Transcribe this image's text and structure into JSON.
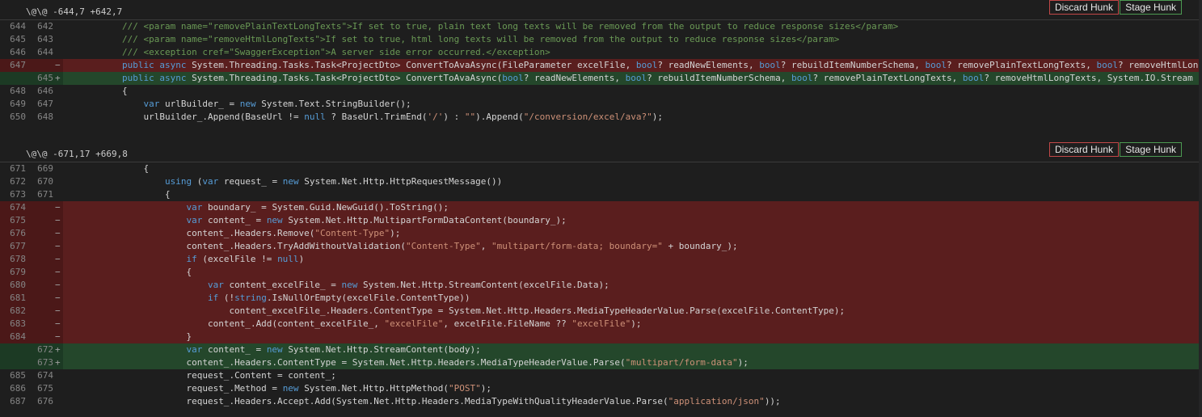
{
  "hunks": [
    {
      "title": "\\@\\@ -644,7 +642,7",
      "discard_label": "Discard Hunk",
      "stage_label": "Stage Hunk",
      "lines": [
        {
          "old": "644",
          "new": "642",
          "mark": "",
          "type": "ctx",
          "text": "        /// <param name=\"removePlainTextLongTexts\">If set to true, plain text long texts will be removed from the output to reduce response sizes</param>"
        },
        {
          "old": "645",
          "new": "643",
          "mark": "",
          "type": "ctx",
          "text": "        /// <param name=\"removeHtmlLongTexts\">If set to true, html long texts will be removed from the output to reduce response sizes</param>"
        },
        {
          "old": "646",
          "new": "644",
          "mark": "",
          "type": "ctx",
          "text": "        /// <exception cref=\"SwaggerException\">A server side error occurred.</exception>"
        },
        {
          "old": "647",
          "new": "",
          "mark": "−",
          "type": "del",
          "text": "        public async System.Threading.Tasks.Task<ProjectDto> ConvertToAvaAsync(FileParameter excelFile, bool? readNewElements, bool? rebuildItemNumberSchema, bool? removePlainTextLongTexts, bool? removeHtmlLongTex"
        },
        {
          "old": "",
          "new": "645",
          "mark": "+",
          "type": "add",
          "text": "        public async System.Threading.Tasks.Task<ProjectDto> ConvertToAvaAsync(bool? readNewElements, bool? rebuildItemNumberSchema, bool? removePlainTextLongTexts, bool? removeHtmlLongTexts, System.IO.Stream body"
        },
        {
          "old": "648",
          "new": "646",
          "mark": "",
          "type": "ctx",
          "text": "        {"
        },
        {
          "old": "649",
          "new": "647",
          "mark": "",
          "type": "ctx",
          "text": "            var urlBuilder_ = new System.Text.StringBuilder();"
        },
        {
          "old": "650",
          "new": "648",
          "mark": "",
          "type": "ctx",
          "text": "            urlBuilder_.Append(BaseUrl != null ? BaseUrl.TrimEnd('/') : \"\").Append(\"/conversion/excel/ava?\");"
        }
      ]
    },
    {
      "title": "\\@\\@ -671,17 +669,8",
      "discard_label": "Discard Hunk",
      "stage_label": "Stage Hunk",
      "lines": [
        {
          "old": "671",
          "new": "669",
          "mark": "",
          "type": "ctx",
          "text": "            {"
        },
        {
          "old": "672",
          "new": "670",
          "mark": "",
          "type": "ctx",
          "text": "                using (var request_ = new System.Net.Http.HttpRequestMessage())"
        },
        {
          "old": "673",
          "new": "671",
          "mark": "",
          "type": "ctx",
          "text": "                {"
        },
        {
          "old": "674",
          "new": "",
          "mark": "−",
          "type": "del",
          "text": "                    var boundary_ = System.Guid.NewGuid().ToString();"
        },
        {
          "old": "675",
          "new": "",
          "mark": "−",
          "type": "del",
          "text": "                    var content_ = new System.Net.Http.MultipartFormDataContent(boundary_);"
        },
        {
          "old": "676",
          "new": "",
          "mark": "−",
          "type": "del",
          "text": "                    content_.Headers.Remove(\"Content-Type\");"
        },
        {
          "old": "677",
          "new": "",
          "mark": "−",
          "type": "del",
          "text": "                    content_.Headers.TryAddWithoutValidation(\"Content-Type\", \"multipart/form-data; boundary=\" + boundary_);"
        },
        {
          "old": "678",
          "new": "",
          "mark": "−",
          "type": "del",
          "text": "                    if (excelFile != null)"
        },
        {
          "old": "679",
          "new": "",
          "mark": "−",
          "type": "del",
          "text": "                    {"
        },
        {
          "old": "680",
          "new": "",
          "mark": "−",
          "type": "del",
          "text": "                        var content_excelFile_ = new System.Net.Http.StreamContent(excelFile.Data);"
        },
        {
          "old": "681",
          "new": "",
          "mark": "−",
          "type": "del",
          "text": "                        if (!string.IsNullOrEmpty(excelFile.ContentType))"
        },
        {
          "old": "682",
          "new": "",
          "mark": "−",
          "type": "del",
          "text": "                            content_excelFile_.Headers.ContentType = System.Net.Http.Headers.MediaTypeHeaderValue.Parse(excelFile.ContentType);"
        },
        {
          "old": "683",
          "new": "",
          "mark": "−",
          "type": "del",
          "text": "                        content_.Add(content_excelFile_, \"excelFile\", excelFile.FileName ?? \"excelFile\");"
        },
        {
          "old": "684",
          "new": "",
          "mark": "−",
          "type": "del",
          "text": "                    }"
        },
        {
          "old": "",
          "new": "672",
          "mark": "+",
          "type": "add",
          "text": "                    var content_ = new System.Net.Http.StreamContent(body);"
        },
        {
          "old": "",
          "new": "673",
          "mark": "+",
          "type": "add",
          "text": "                    content_.Headers.ContentType = System.Net.Http.Headers.MediaTypeHeaderValue.Parse(\"multipart/form-data\");"
        },
        {
          "old": "685",
          "new": "674",
          "mark": "",
          "type": "ctx",
          "text": "                    request_.Content = content_;"
        },
        {
          "old": "686",
          "new": "675",
          "mark": "",
          "type": "ctx",
          "text": "                    request_.Method = new System.Net.Http.HttpMethod(\"POST\");"
        },
        {
          "old": "687",
          "new": "676",
          "mark": "",
          "type": "ctx",
          "text": "                    request_.Headers.Accept.Add(System.Net.Http.Headers.MediaTypeWithQualityHeaderValue.Parse(\"application/json\"));"
        }
      ]
    }
  ]
}
